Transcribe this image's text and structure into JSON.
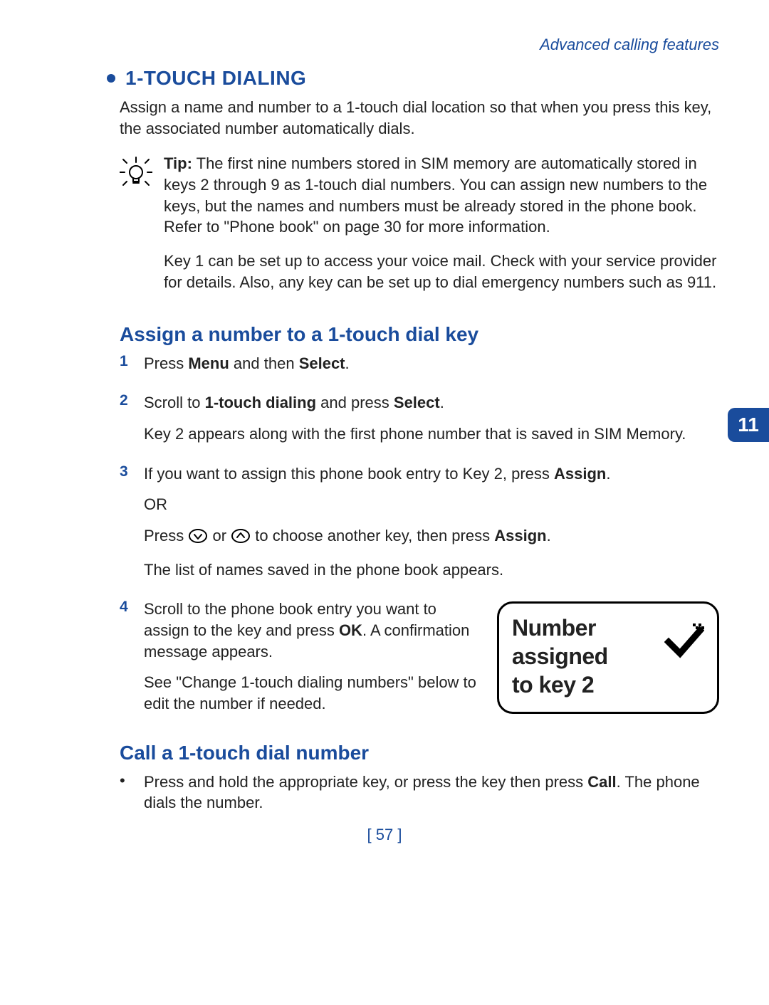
{
  "header": {
    "section": "Advanced calling features"
  },
  "title": "1-TOUCH DIALING",
  "intro": "Assign a name and number to a 1-touch dial location so that when you press this key, the associated number automatically dials.",
  "tip": {
    "label": "Tip:",
    "p1_rest": " The first nine numbers stored in SIM memory are automatically stored in keys 2 through 9 as 1-touch dial numbers. You can assign new numbers to the keys, but the names and numbers must be already stored in the phone book. Refer to \"Phone book\" on page 30 for more information.",
    "p2": "Key 1 can be set up to access your voice mail. Check with your service provider for details. Also, any key can be set up to dial emergency numbers such as 911."
  },
  "section_a": {
    "heading": "Assign a number to a 1-touch dial key",
    "steps": {
      "s1": {
        "num": "1",
        "t1": "Press ",
        "b1": "Menu",
        "t2": " and then ",
        "b2": "Select",
        "t3": "."
      },
      "s2": {
        "num": "2",
        "t1": "Scroll to ",
        "b1": "1-touch dialing",
        "t2": " and press ",
        "b2": "Select",
        "t3": ".",
        "after": "Key 2 appears along with the first phone number that is saved in SIM Memory."
      },
      "s3": {
        "num": "3",
        "t1": "If you want to assign this phone book entry to Key 2, press ",
        "b1": "Assign",
        "t2": ".",
        "or": "OR",
        "p3a": "Press  ",
        "p3b": "  or  ",
        "p3c": "  to choose another key, then press ",
        "b2": "Assign",
        "p3d": ".",
        "p4": "The list of names saved in the phone book appears."
      },
      "s4": {
        "num": "4",
        "p1a": "Scroll to the phone book entry you want to assign to the key and press ",
        "b1": "OK",
        "p1b": ". A confirmation message appears.",
        "p2": "See \"Change 1-touch dialing numbers\" below to edit the number if needed."
      }
    }
  },
  "screen": {
    "line1": "Number",
    "line2": "assigned",
    "line3": "to key 2"
  },
  "section_b": {
    "heading": "Call a 1-touch dial number",
    "bullet_t1": "Press and hold the appropriate key, or press the key then press ",
    "bullet_b1": "Call",
    "bullet_t2": ". The phone dials the number."
  },
  "chapter": "11",
  "page_number": "[ 57 ]"
}
